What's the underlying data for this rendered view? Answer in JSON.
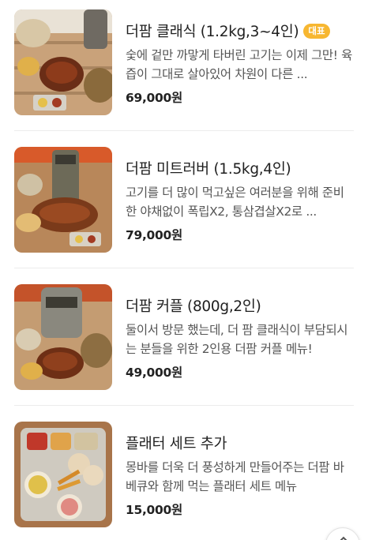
{
  "menu": {
    "items": [
      {
        "name": "더팜 클래식 (1.2kg,3~4인)",
        "badge": "대표",
        "description": "숯에 겉만 까맣게 타버린 고기는 이제 그만! 육즙이 그대로 살아있어 차원이 다른 ...",
        "price": "69,000원"
      },
      {
        "name": "더팜 미트러버 (1.5kg,4인)",
        "badge": "",
        "description": "고기를 더 많이 먹고싶은 여러분을 위해 준비한 야채없이 폭립X2, 통삼겹살X2로 ...",
        "price": "79,000원"
      },
      {
        "name": "더팜 커플 (800g,2인)",
        "badge": "",
        "description": "둘이서 방문 했는데, 더 팜 클래식이 부담되시는 분들을 위한 2인용 더팜 커플 메뉴!",
        "price": "49,000원"
      },
      {
        "name": "플래터 세트 추가",
        "badge": "",
        "description": "몽바를 더욱 더 풍성하게 만들어주는 더팜 바베큐와 함께 먹는 플래터 세트 메뉴",
        "price": "15,000원"
      }
    ]
  },
  "icons": {
    "scroll_button": "chevron-up-icon"
  },
  "colors": {
    "badge": "#f7b731",
    "price": "#222222",
    "divider": "#ececec"
  }
}
